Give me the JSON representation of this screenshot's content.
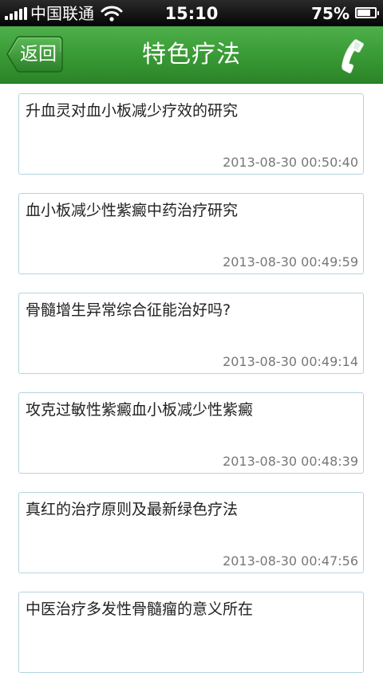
{
  "status_bar": {
    "carrier": "中国联通",
    "time": "15:10",
    "battery": "75%",
    "battery_level": 0.75,
    "icons": [
      "signal-icon",
      "wifi-icon",
      "battery-icon"
    ]
  },
  "header": {
    "back_label": "返回",
    "title": "特色疗法",
    "phone_icon": "phone-icon",
    "colors": {
      "header_green": "#3a9b36",
      "text": "#ffffff"
    }
  },
  "list": {
    "items": [
      {
        "title": "升血灵对血小板减少疗效的研究",
        "date": "2013-08-30 00:50:40"
      },
      {
        "title": "血小板减少性紫癜中药治疗研究",
        "date": "2013-08-30 00:49:59"
      },
      {
        "title": "骨髓增生异常综合征能治好吗?",
        "date": "2013-08-30 00:49:14"
      },
      {
        "title": "攻克过敏性紫癜血小板减少性紫癜",
        "date": "2013-08-30 00:48:39"
      },
      {
        "title": "真红的治疗原则及最新绿色疗法",
        "date": "2013-08-30 00:47:56"
      },
      {
        "title": "中医治疗多发性骨髓瘤的意义所在",
        "date": ""
      }
    ]
  }
}
